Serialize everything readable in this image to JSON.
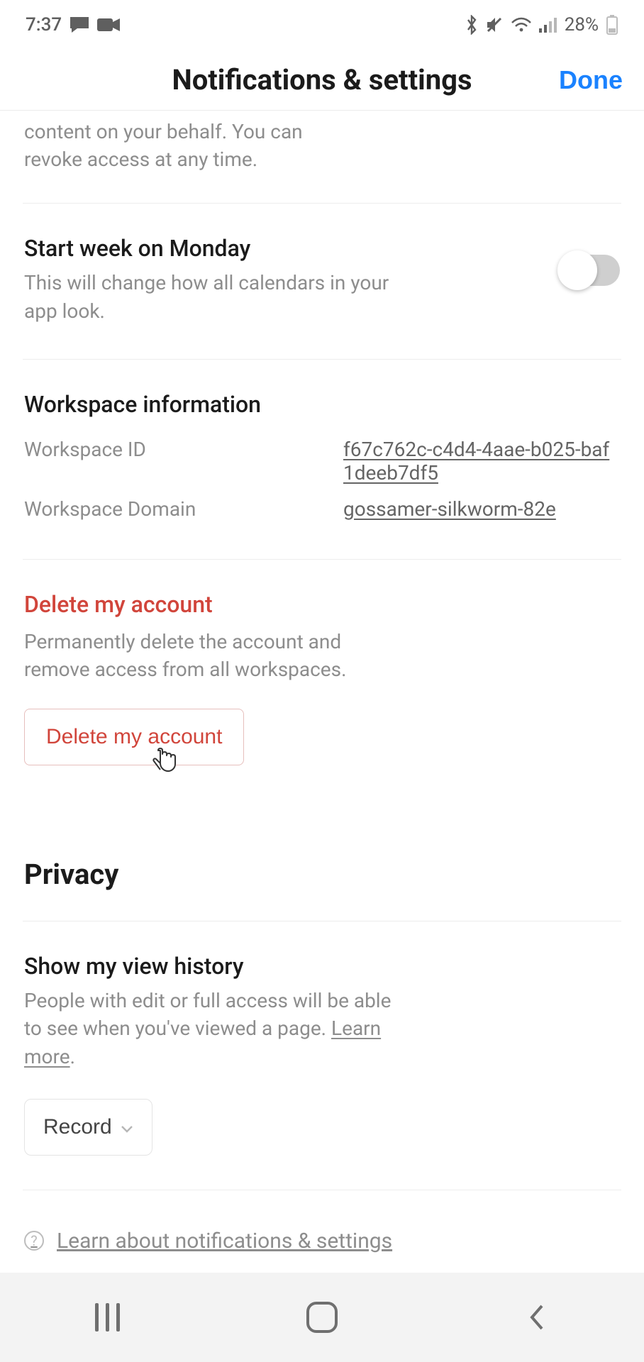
{
  "status": {
    "time": "7:37",
    "battery": "28%"
  },
  "header": {
    "title": "Notifications & settings",
    "done": "Done"
  },
  "partial_top": {
    "desc": "content on your behalf. You can revoke access at any time."
  },
  "start_week": {
    "title": "Start week on Monday",
    "desc": "This will change how all calendars in your app look."
  },
  "workspace": {
    "heading": "Workspace information",
    "id_label": "Workspace ID",
    "id_value": "f67c762c-c4d4-4aae-b025-baf1deeb7df5",
    "domain_label": "Workspace Domain",
    "domain_value": "gossamer-silkworm-82e"
  },
  "delete": {
    "title": "Delete my account",
    "desc": "Permanently delete the account and remove access from all workspaces.",
    "button": "Delete my account"
  },
  "privacy": {
    "heading": "Privacy"
  },
  "view_history": {
    "title": "Show my view history",
    "desc_prefix": "People with edit or full access will be able to see when you've viewed a page. ",
    "learn_more": "Learn more",
    "select_label": "Record"
  },
  "footer_link": {
    "text": "Learn about notifications & settings"
  }
}
